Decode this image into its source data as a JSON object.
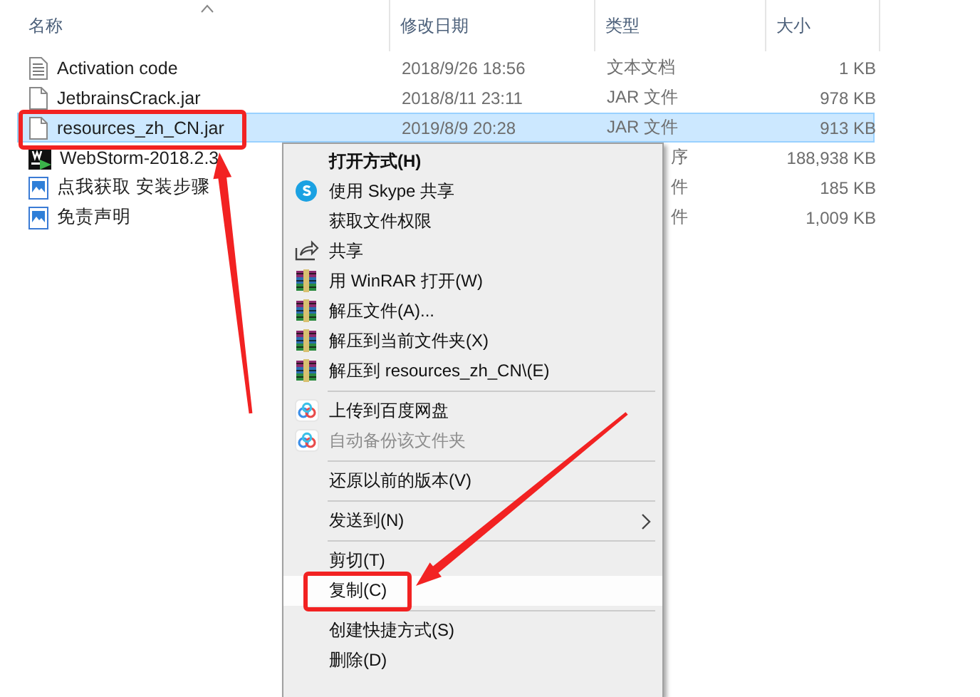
{
  "columns": [
    {
      "label": "名称",
      "sorted": true
    },
    {
      "label": "修改日期",
      "sorted": false
    },
    {
      "label": "类型",
      "sorted": false
    },
    {
      "label": "大小",
      "sorted": false
    }
  ],
  "files": [
    {
      "name": "Activation code",
      "date": "2018/9/26 18:56",
      "type": "文本文档",
      "size": "1 KB",
      "kind": "text",
      "selected": false,
      "covered": false
    },
    {
      "name": "JetbrainsCrack.jar",
      "date": "2018/8/11 23:11",
      "type": "JAR 文件",
      "size": "978 KB",
      "kind": "file",
      "selected": false,
      "covered": false
    },
    {
      "name": "resources_zh_CN.jar",
      "date": "2019/8/9 20:28",
      "type": "JAR 文件",
      "size": "913 KB",
      "kind": "file",
      "selected": true,
      "covered": false
    },
    {
      "name": "WebStorm-2018.2.3",
      "type": "序",
      "size": "188,938 KB",
      "kind": "app",
      "selected": false,
      "covered": true
    },
    {
      "name": "点我获取 安装步骤",
      "type": "件",
      "size": "185 KB",
      "kind": "image",
      "selected": false,
      "covered": true
    },
    {
      "name": "免责声明",
      "type": "件",
      "size": "1,009 KB",
      "kind": "image",
      "selected": false,
      "covered": true
    }
  ],
  "menu": {
    "items": [
      {
        "kind": "item",
        "label": "打开方式(H)",
        "default": true,
        "disabled": false,
        "selected": false,
        "submenu": false
      },
      {
        "kind": "skype-item",
        "label": "使用 Skype 共享",
        "default": false,
        "disabled": false,
        "selected": false,
        "submenu": false
      },
      {
        "kind": "item",
        "label": "获取文件权限",
        "default": false,
        "disabled": false,
        "selected": false,
        "submenu": false
      },
      {
        "kind": "share-item",
        "label": "共享",
        "default": false,
        "disabled": false,
        "selected": false,
        "submenu": false
      },
      {
        "kind": "archive-item",
        "label": "用 WinRAR 打开(W)",
        "default": false,
        "disabled": false,
        "selected": false,
        "submenu": false
      },
      {
        "kind": "archive-item",
        "label": "解压文件(A)...",
        "default": false,
        "disabled": false,
        "selected": false,
        "submenu": false
      },
      {
        "kind": "archive-item",
        "label": "解压到当前文件夹(X)",
        "default": false,
        "disabled": false,
        "selected": false,
        "submenu": false
      },
      {
        "kind": "archive-item",
        "label": "解压到 resources_zh_CN\\(E)",
        "default": false,
        "disabled": false,
        "selected": false,
        "submenu": false
      },
      {
        "kind": "separator"
      },
      {
        "kind": "cloud-item",
        "label": "上传到百度网盘",
        "default": false,
        "disabled": false,
        "selected": false,
        "submenu": false
      },
      {
        "kind": "cloud-item",
        "label": "自动备份该文件夹",
        "default": false,
        "disabled": true,
        "selected": false,
        "submenu": false
      },
      {
        "kind": "separator"
      },
      {
        "kind": "item",
        "label": "还原以前的版本(V)",
        "default": false,
        "disabled": false,
        "selected": false,
        "submenu": false
      },
      {
        "kind": "separator"
      },
      {
        "kind": "item",
        "label": "发送到(N)",
        "default": false,
        "disabled": false,
        "selected": false,
        "submenu": true
      },
      {
        "kind": "separator"
      },
      {
        "kind": "item",
        "label": "剪切(T)",
        "default": false,
        "disabled": false,
        "selected": false,
        "submenu": false
      },
      {
        "kind": "item",
        "label": "复制(C)",
        "default": false,
        "disabled": false,
        "selected": true,
        "submenu": false
      },
      {
        "kind": "separator"
      },
      {
        "kind": "item",
        "label": "创建快捷方式(S)",
        "default": false,
        "disabled": false,
        "selected": false,
        "submenu": false
      },
      {
        "kind": "item",
        "label": "删除(D)",
        "default": false,
        "disabled": false,
        "selected": false,
        "submenu": false
      }
    ]
  },
  "annotations": [
    {
      "kind": "box"
    },
    {
      "kind": "box"
    },
    {
      "kind": "arrow"
    },
    {
      "kind": "arrow"
    }
  ]
}
